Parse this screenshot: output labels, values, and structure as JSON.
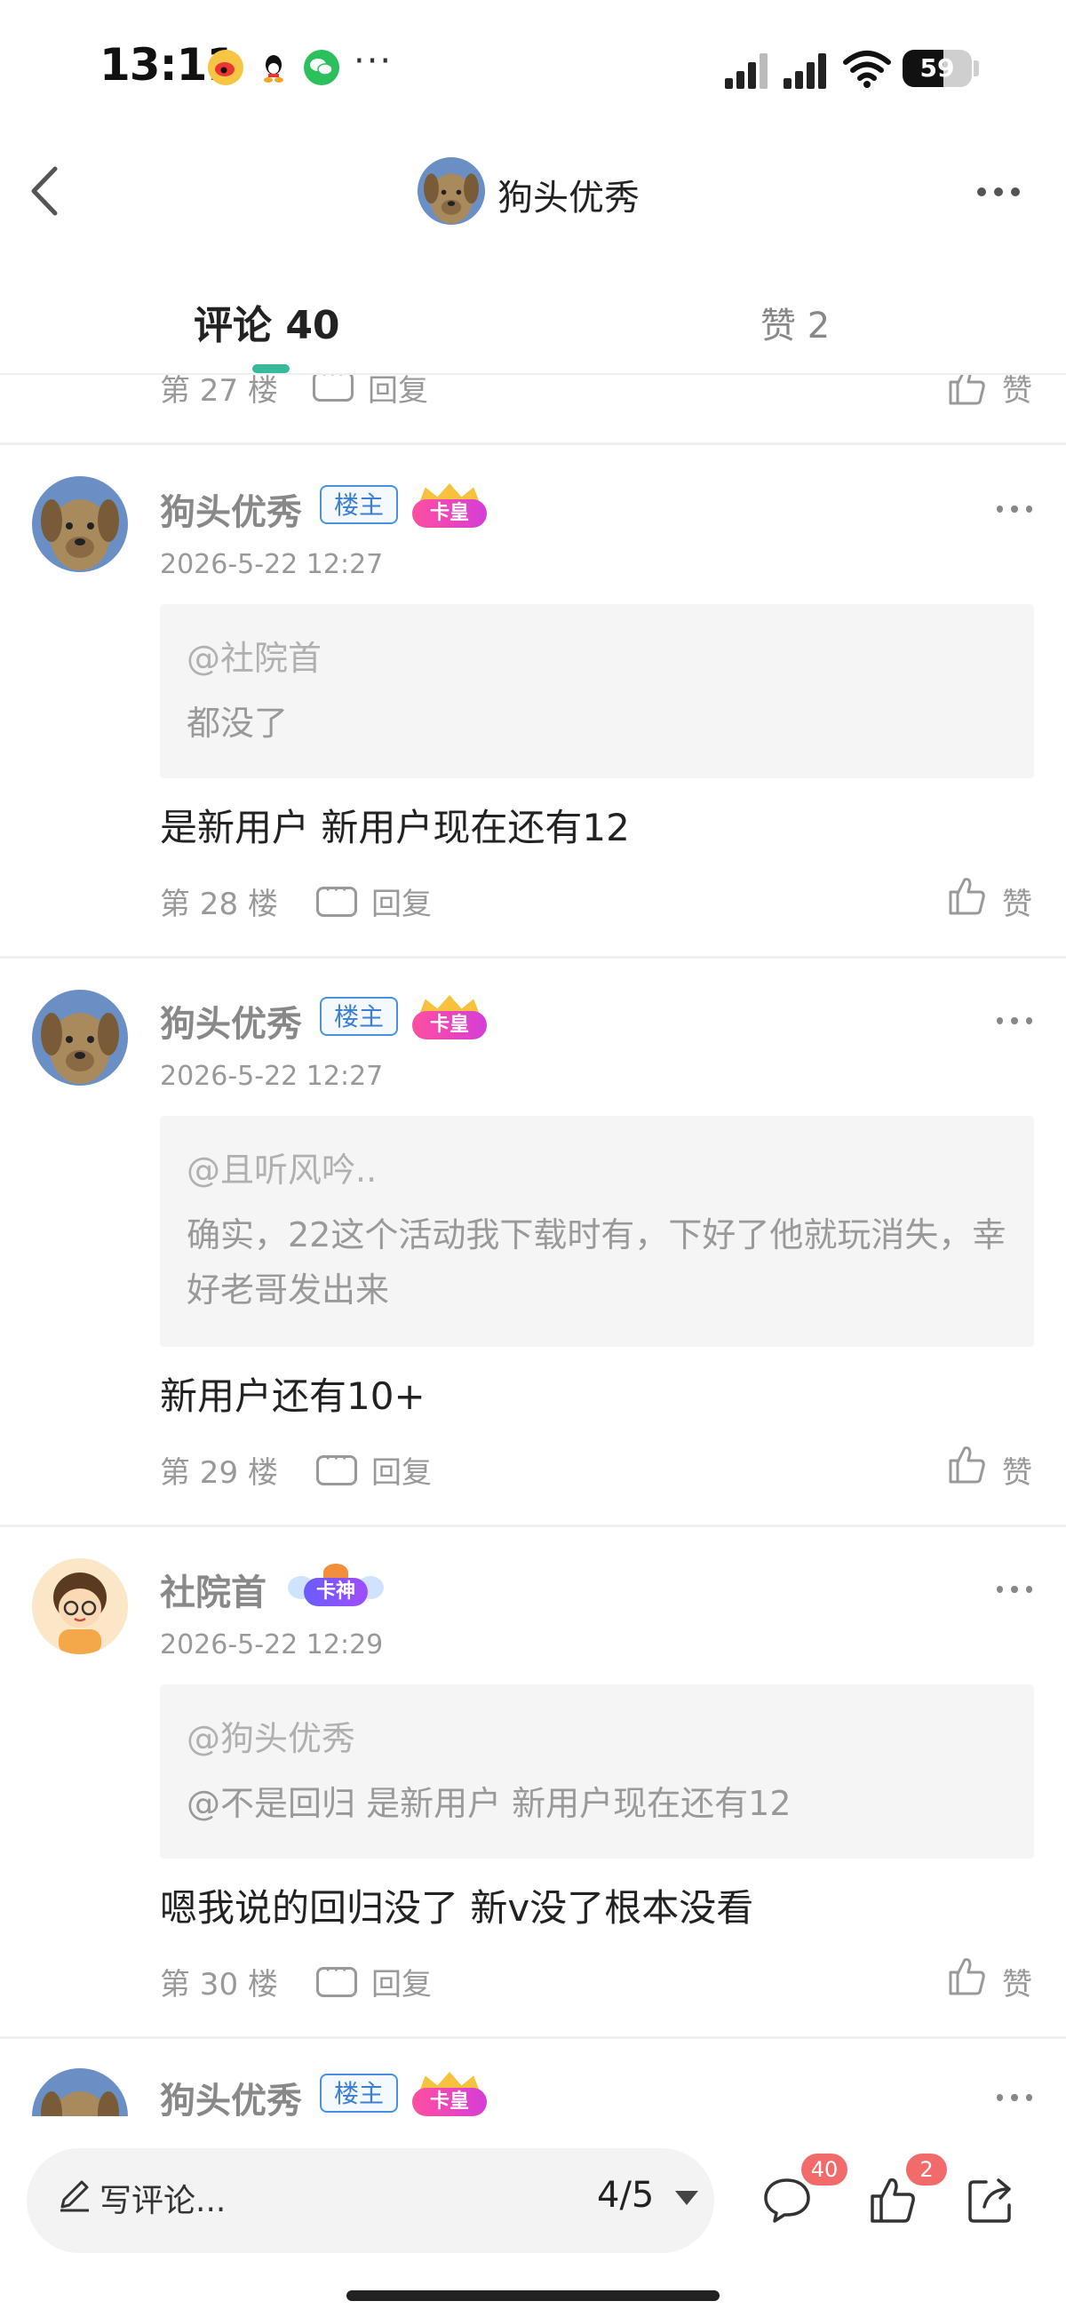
{
  "status_bar": {
    "time": "13:11",
    "app_icons": [
      "weibo-icon",
      "qq-icon",
      "wechat-icon"
    ],
    "more": "···",
    "battery": "59",
    "battery_fraction": 0.59
  },
  "nav": {
    "title": "狗头优秀"
  },
  "tabs": {
    "comments": "评论 40",
    "likes": "赞 2"
  },
  "comments": [
    {
      "floor": "第 27 楼",
      "reply": "回复",
      "like": "赞"
    },
    {
      "username": "狗头优秀",
      "owner_badge": "楼主",
      "level_badge": "卡皇",
      "time": "2026-5-22 12:27",
      "quote_user": "@社院首",
      "quote_text": "都没了",
      "text": "是新用户 新用户现在还有12",
      "floor": "第 28 楼",
      "reply": "回复",
      "like": "赞"
    },
    {
      "username": "狗头优秀",
      "owner_badge": "楼主",
      "level_badge": "卡皇",
      "time": "2026-5-22 12:27",
      "quote_user": "@且听风吟..",
      "quote_text": "确实，22这个活动我下载时有，下好了他就玩消失，幸好老哥发出来",
      "text": "新用户还有10+",
      "floor": "第 29 楼",
      "reply": "回复",
      "like": "赞"
    },
    {
      "username": "社院首",
      "level_badge": "卡神",
      "time": "2026-5-22 12:29",
      "quote_user": "@狗头优秀",
      "quote_text": "@不是回归 是新用户 新用户现在还有12",
      "text": "嗯我说的回归没了  新v没了根本没看",
      "floor": "第 30 楼",
      "reply": "回复",
      "like": "赞"
    },
    {
      "username": "狗头优秀",
      "owner_badge": "楼主",
      "level_badge": "卡皇"
    }
  ],
  "bottom_bar": {
    "placeholder": "写评论...",
    "page": "4/5",
    "comment_count": "40",
    "like_count": "2"
  },
  "colors": {
    "accent": "#38b99a",
    "owner_badge": "#3a7fd5",
    "count_badge": "#f26b6b"
  }
}
